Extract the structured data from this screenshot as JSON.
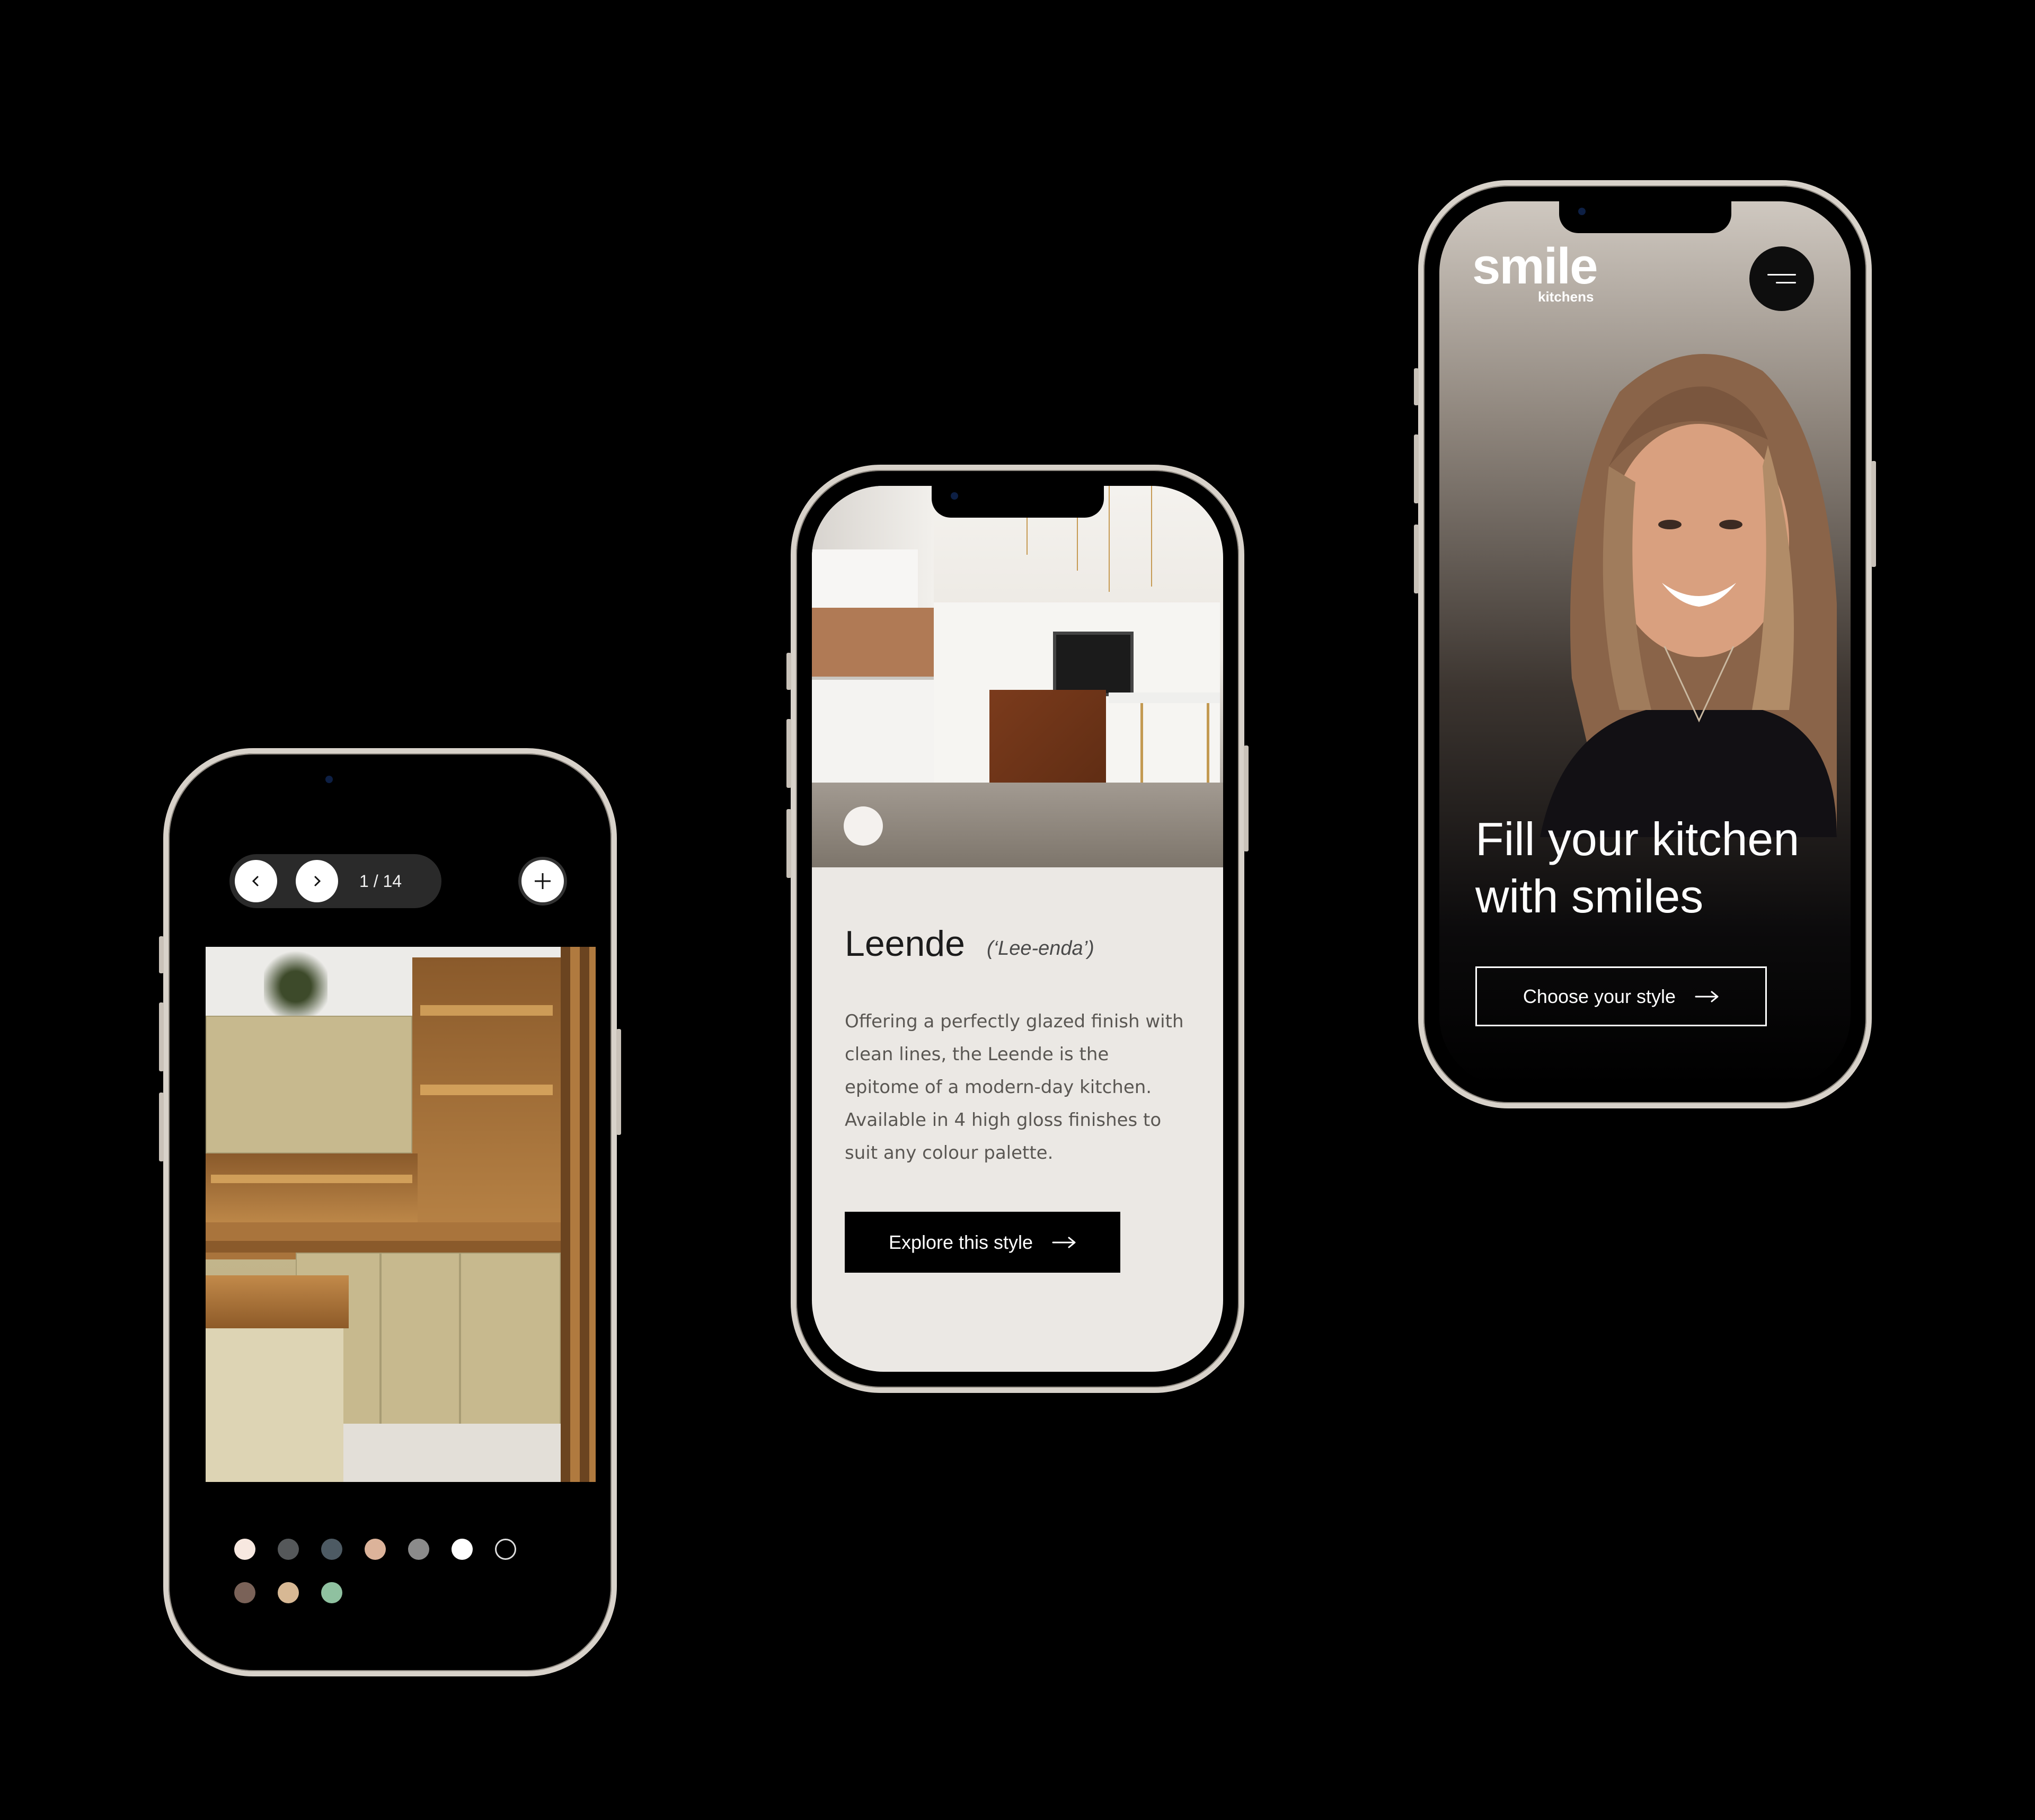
{
  "gallery": {
    "counter": "1 / 14",
    "swatches": [
      "#f7e8e0",
      "#55585a",
      "#4d5a63",
      "#dcb39a",
      "#8b8b8b",
      "#ffffff",
      "#000000",
      "#7a6258",
      "#d7b894",
      "#8fc1a0"
    ]
  },
  "product": {
    "title": "Leende",
    "pronunciation": "(‘Lee-enda’)",
    "description": "Offering a perfectly glazed finish with clean lines, the Leende is the epitome of a modern-day kitchen. Available in 4 high gloss finishes to suit any colour palette.",
    "cta_label": "Explore this style"
  },
  "home": {
    "logo_main": "smile",
    "logo_sub": "kitchens",
    "headline_line1": "Fill your kitchen",
    "headline_line2": "with smiles",
    "cta_label": "Choose your style"
  }
}
